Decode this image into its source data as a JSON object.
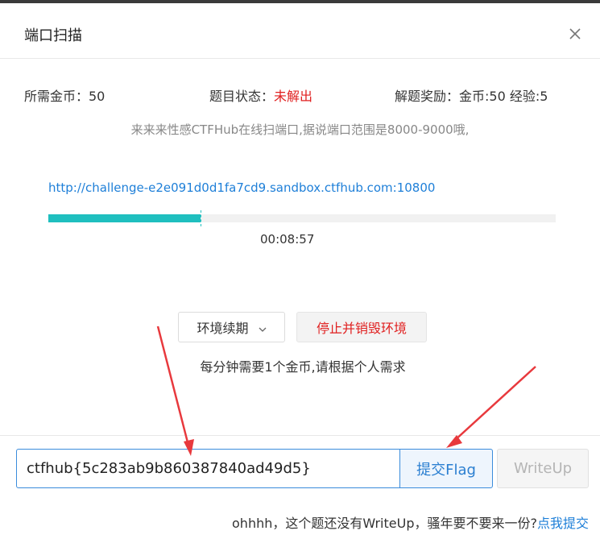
{
  "dialog": {
    "title": "端口扫描",
    "close_icon": "close-icon"
  },
  "info": {
    "cost": "所需金币：50",
    "status_label": "题目状态：",
    "status_value": "未解出",
    "reward": "解题奖励：金币:50 经验:5"
  },
  "description": "来来来性感CTFHub在线扫端口,据说端口范围是8000-9000哦,",
  "challenge": {
    "url": "http://challenge-e2e091d0d1fa7cd9.sandbox.ctfhub.com:10800",
    "progress": 0.3,
    "timer": "00:08:57"
  },
  "actions": {
    "renew_label": "环境续期",
    "renew_icon": "chevron-down-icon",
    "stop_label": "停止并销毁环境",
    "note": "每分钟需要1个金币,请根据个人需求"
  },
  "submit": {
    "flag_value": "ctfhub{5c283ab9b860387840ad49d5}",
    "submit_label": "提交Flag",
    "writeup_label": "WriteUp"
  },
  "footer": {
    "text": "ohhhh，这个题还没有WriteUp，骚年要不要来一份?",
    "link": "点我提交"
  },
  "colors": {
    "accent": "#1e7fd8",
    "progress": "#1fbfbf",
    "danger": "#e02020",
    "annotation_arrow": "#e8393d"
  }
}
